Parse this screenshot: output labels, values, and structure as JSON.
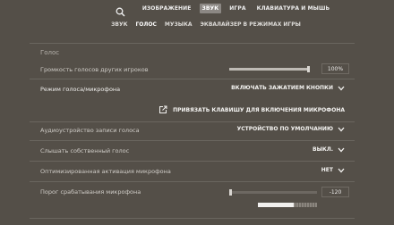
{
  "top_nav": {
    "tabs": [
      {
        "label": "ИЗОБРАЖЕНИЕ",
        "active": false
      },
      {
        "label": "ЗВУК",
        "active": true
      },
      {
        "label": "ИГРА",
        "active": false
      },
      {
        "label": "КЛАВИАТУРА И МЫШЬ",
        "active": false
      }
    ],
    "search_icon": "search-icon"
  },
  "sub_nav": {
    "tabs": [
      {
        "label": "ЗВУК",
        "active": false
      },
      {
        "label": "ГОЛОС",
        "active": true
      },
      {
        "label": "МУЗЫКА",
        "active": false
      },
      {
        "label": "ЭКВАЛАЙЗЕР В РЕЖИМАХ ИГРЫ",
        "active": false
      }
    ]
  },
  "section": {
    "title": "Голос",
    "other_volume": {
      "label": "Громкость голосов других игроков",
      "value": "100%",
      "fraction": 1.0
    },
    "voice_mode": {
      "label": "Режим голоса/микрофона",
      "value": "ВКЛЮЧАТЬ ЗАЖАТИЕМ КНОПКИ"
    },
    "bind_key": {
      "label": "ПРИВЯЗАТЬ КЛАВИШУ ДЛЯ ВКЛЮЧЕНИЯ МИКРОФОНА"
    },
    "audio_device": {
      "label": "Аудиоустройство записи голоса",
      "value": "УСТРОЙСТВО ПО УМОЛЧАНИЮ"
    },
    "hear_own": {
      "label": "Слышать собственный голос",
      "value": "ВЫКЛ."
    },
    "optimized_activation": {
      "label": "Оптимизированная активация микрофона",
      "value": "НЕТ"
    },
    "mic_threshold": {
      "label": "Порог срабатывания микрофона",
      "value": "-120",
      "fraction": 0.02,
      "meter_level": 0.6
    }
  },
  "colors": {
    "background": "#544f48",
    "active_tab": "#8c8884",
    "slider_fill": "#bebab4"
  }
}
